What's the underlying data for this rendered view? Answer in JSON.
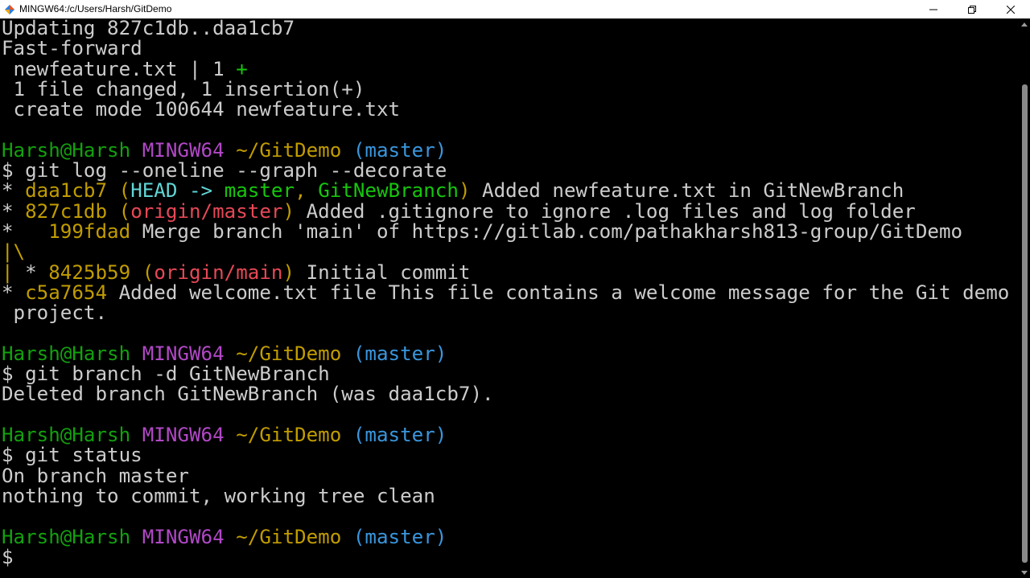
{
  "window": {
    "title": "MINGW64:/c/Users/Harsh/GitDemo",
    "colors": {
      "bg": "#000000",
      "text": "#cccccc",
      "green": "#13a10e",
      "magenta": "#b148c6",
      "yellow": "#c19c00",
      "cyan": "#3a96dd",
      "brightcyan": "#61d6d6",
      "red": "#e74856",
      "brightgreen": "#16c60c"
    }
  },
  "terminal": {
    "lines": [
      [
        {
          "t": "Updating 827c1db..daa1cb7",
          "c": "text"
        }
      ],
      [
        {
          "t": "Fast-forward",
          "c": "text"
        }
      ],
      [
        {
          "t": " newfeature.txt | 1 ",
          "c": "text"
        },
        {
          "t": "+",
          "c": "brightgreen"
        }
      ],
      [
        {
          "t": " 1 file changed, 1 insertion(+)",
          "c": "text"
        }
      ],
      [
        {
          "t": " create mode 100644 newfeature.txt",
          "c": "text"
        }
      ],
      [],
      [
        {
          "t": "Harsh@Harsh ",
          "c": "green"
        },
        {
          "t": "MINGW64 ",
          "c": "magenta"
        },
        {
          "t": "~/GitDemo ",
          "c": "yellow"
        },
        {
          "t": "(master)",
          "c": "cyan"
        }
      ],
      [
        {
          "t": "$ git log --oneline --graph --decorate",
          "c": "text"
        }
      ],
      [
        {
          "t": "* ",
          "c": "text"
        },
        {
          "t": "daa1cb7 ",
          "c": "yellow"
        },
        {
          "t": "(",
          "c": "yellow"
        },
        {
          "t": "HEAD -> ",
          "c": "brightcyan"
        },
        {
          "t": "master",
          "c": "brightgreen"
        },
        {
          "t": ", ",
          "c": "yellow"
        },
        {
          "t": "GitNewBranch",
          "c": "brightgreen"
        },
        {
          "t": ")",
          "c": "yellow"
        },
        {
          "t": " Added newfeature.txt in GitNewBranch",
          "c": "text"
        }
      ],
      [
        {
          "t": "* ",
          "c": "text"
        },
        {
          "t": "827c1db ",
          "c": "yellow"
        },
        {
          "t": "(",
          "c": "yellow"
        },
        {
          "t": "origin/master",
          "c": "red"
        },
        {
          "t": ")",
          "c": "yellow"
        },
        {
          "t": " Added .gitignore to ignore .log files and log folder",
          "c": "text"
        }
      ],
      [
        {
          "t": "*   ",
          "c": "text"
        },
        {
          "t": "199fdad",
          "c": "yellow"
        },
        {
          "t": " Merge branch 'main' of https://gitlab.com/pathakharsh813-group/GitDemo",
          "c": "text"
        }
      ],
      [
        {
          "t": "|\\",
          "c": "yellow"
        }
      ],
      [
        {
          "t": "|",
          "c": "yellow"
        },
        {
          "t": " * ",
          "c": "text"
        },
        {
          "t": "8425b59 ",
          "c": "yellow"
        },
        {
          "t": "(",
          "c": "yellow"
        },
        {
          "t": "origin/main",
          "c": "red"
        },
        {
          "t": ")",
          "c": "yellow"
        },
        {
          "t": " Initial commit",
          "c": "text"
        }
      ],
      [
        {
          "t": "* ",
          "c": "text"
        },
        {
          "t": "c5a7654",
          "c": "yellow"
        },
        {
          "t": " Added welcome.txt file This file contains a welcome message for the Git demo",
          "c": "text"
        }
      ],
      [
        {
          "t": " project.",
          "c": "text"
        }
      ],
      [],
      [
        {
          "t": "Harsh@Harsh ",
          "c": "green"
        },
        {
          "t": "MINGW64 ",
          "c": "magenta"
        },
        {
          "t": "~/GitDemo ",
          "c": "yellow"
        },
        {
          "t": "(master)",
          "c": "cyan"
        }
      ],
      [
        {
          "t": "$ git branch -d GitNewBranch",
          "c": "text"
        }
      ],
      [
        {
          "t": "Deleted branch GitNewBranch (was daa1cb7).",
          "c": "text"
        }
      ],
      [],
      [
        {
          "t": "Harsh@Harsh ",
          "c": "green"
        },
        {
          "t": "MINGW64 ",
          "c": "magenta"
        },
        {
          "t": "~/GitDemo ",
          "c": "yellow"
        },
        {
          "t": "(master)",
          "c": "cyan"
        }
      ],
      [
        {
          "t": "$ git status",
          "c": "text"
        }
      ],
      [
        {
          "t": "On branch master",
          "c": "text"
        }
      ],
      [
        {
          "t": "nothing to commit, working tree clean",
          "c": "text"
        }
      ],
      [],
      [
        {
          "t": "Harsh@Harsh ",
          "c": "green"
        },
        {
          "t": "MINGW64 ",
          "c": "magenta"
        },
        {
          "t": "~/GitDemo ",
          "c": "yellow"
        },
        {
          "t": "(master)",
          "c": "cyan"
        }
      ],
      [
        {
          "t": "$",
          "c": "text"
        }
      ]
    ]
  }
}
